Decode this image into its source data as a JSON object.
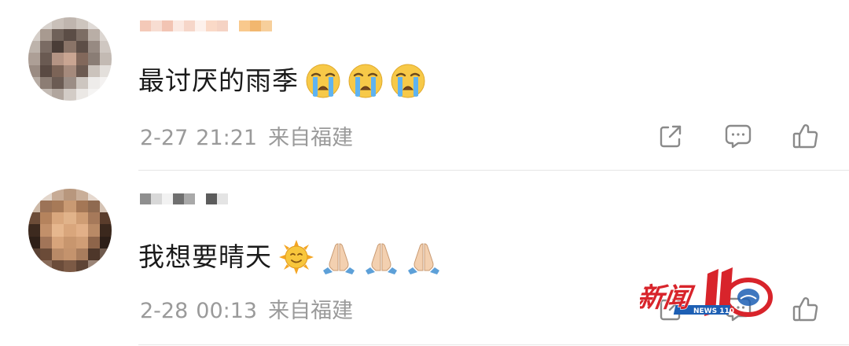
{
  "comments": [
    {
      "text": "最讨厌的雨季",
      "reaction_icons": [
        "loudly-crying-face-icon",
        "loudly-crying-face-icon",
        "loudly-crying-face-icon"
      ],
      "date": "2-27",
      "time": "21:21",
      "source": "来自福建"
    },
    {
      "text": "我想要晴天",
      "reaction_icons": [
        "sun-with-face-icon",
        "folded-hands-icon",
        "folded-hands-icon",
        "folded-hands-icon"
      ],
      "date": "2-28",
      "time": "00:13",
      "source": "来自福建"
    }
  ],
  "actions": [
    "share-icon",
    "comment-icon",
    "like-icon"
  ],
  "watermark": {
    "logo_text": "新闻110",
    "sub_text": "NEWS 110",
    "colors": {
      "primary": "#d8242b",
      "secondary": "#1d5fb4"
    }
  },
  "colors": {
    "text": "#1a1a1a",
    "meta": "#9a9a9a",
    "icon": "#8a8a8a",
    "divider": "#e6e6e6"
  }
}
